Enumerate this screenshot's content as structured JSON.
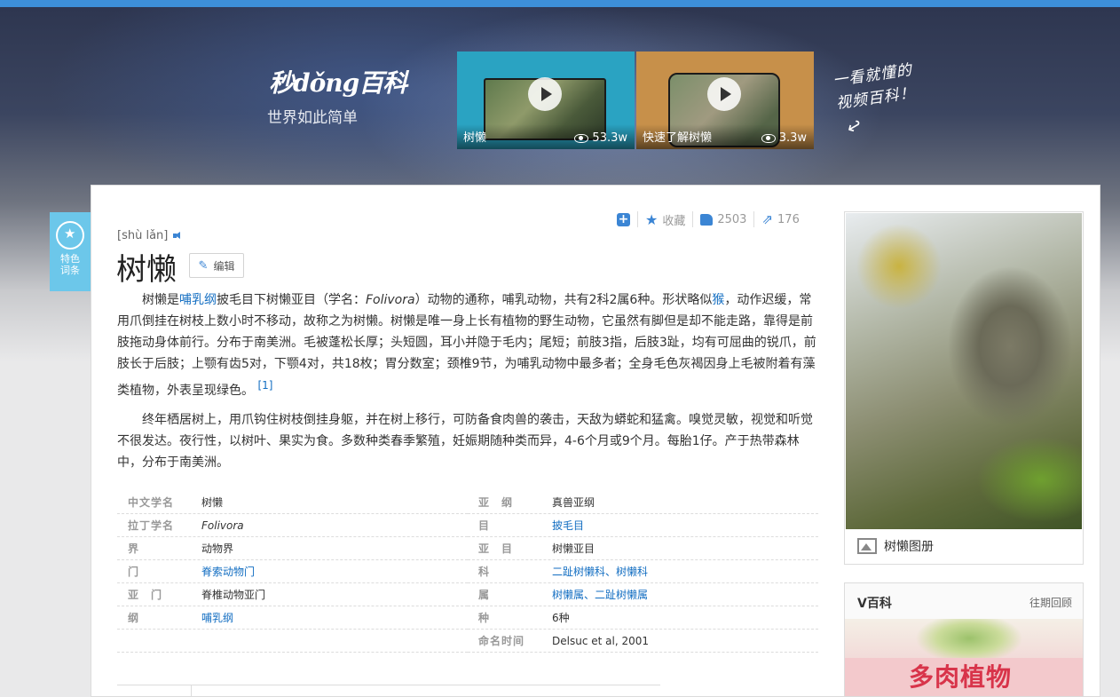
{
  "header": {
    "logo_text": "秒dǒng百科",
    "logo_subtitle": "世界如此简单",
    "slogan_line1": "一看就懂的",
    "slogan_line2": "视频百科！",
    "videos": [
      {
        "title": "树懒",
        "views": "53.3w"
      },
      {
        "title": "快速了解树懒",
        "views": "3.3w"
      }
    ]
  },
  "side_tag": {
    "line1": "特色",
    "line2": "词条"
  },
  "actions": {
    "collect_label": "收藏",
    "likes": "2503",
    "shares": "176"
  },
  "entry": {
    "pinyin": "[shù lǎn]",
    "title": "树懒",
    "edit_label": "编辑",
    "para1": {
      "t1": "树懒是",
      "link1": "哺乳纲",
      "t2": "披毛目下树懒亚目（学名：",
      "latin": "Folivora",
      "t3": "）动物的通称，哺乳动物，共有2科2属6种。形状略似",
      "link2": "猴",
      "t4": "，动作迟缓，常用爪倒挂在树枝上数小时不移动，故称之为树懒。树懒是唯一身上长有植物的野生动物，它虽然有脚但是却不能走路，靠得是前肢拖动身体前行。分布于南美洲。毛被蓬松长厚；头短圆，耳小并隐于毛内；尾短；前肢3指，后肢3趾，均有可屈曲的锐爪，前肢长于后肢；上颚有齿5对，下颚4对，共18枚；胃分数室；颈椎9节，为哺乳动物中最多者；全身毛色灰褐因身上毛被附着有藻类植物，外表呈现绿色。",
      "ref": "[1]"
    },
    "para2": "终年栖居树上，用爪钩住树枝倒挂身躯，并在树上移行，可防备食肉兽的袭击，天敌为蟒蛇和猛禽。嗅觉灵敏，视觉和听觉不很发达。夜行性，以树叶、果实为食。多数种类春季繁殖，妊娠期随种类而异，4-6个月或9个月。每胎1仔。产于热带森林中，分布于南美洲。"
  },
  "infobox": {
    "left": [
      {
        "key": "中文学名",
        "value": "树懒"
      },
      {
        "key": "拉丁学名",
        "value": "Folivora"
      },
      {
        "key": "界",
        "value": "动物界"
      },
      {
        "key": "门",
        "value": "脊索动物门"
      },
      {
        "key": "亚　门",
        "value": "脊椎动物亚门"
      },
      {
        "key": "纲",
        "value": "哺乳纲"
      }
    ],
    "right": [
      {
        "key": "亚　纲",
        "value": "真兽亚纲"
      },
      {
        "key": "目",
        "value": "披毛目"
      },
      {
        "key": "亚　目",
        "value": "树懒亚目"
      },
      {
        "key": "科",
        "value": "二趾树懒科、树懒科"
      },
      {
        "key": "属",
        "value": "树懒属、二趾树懒属"
      },
      {
        "key": "种",
        "value": "6种"
      },
      {
        "key": "命名时间",
        "value": "Delsuc et al, 2001"
      }
    ]
  },
  "sidebar": {
    "photo_caption": "树懒图册",
    "vbaike_title": "V百科",
    "vbaike_more": "往期回顾",
    "vbaike_banner_text": "多肉植物"
  },
  "colors": {
    "accent": "#3b85d4",
    "link": "#136ec2",
    "top_bar": "#3d8fd9",
    "side_tag": "#6cc7ea"
  }
}
